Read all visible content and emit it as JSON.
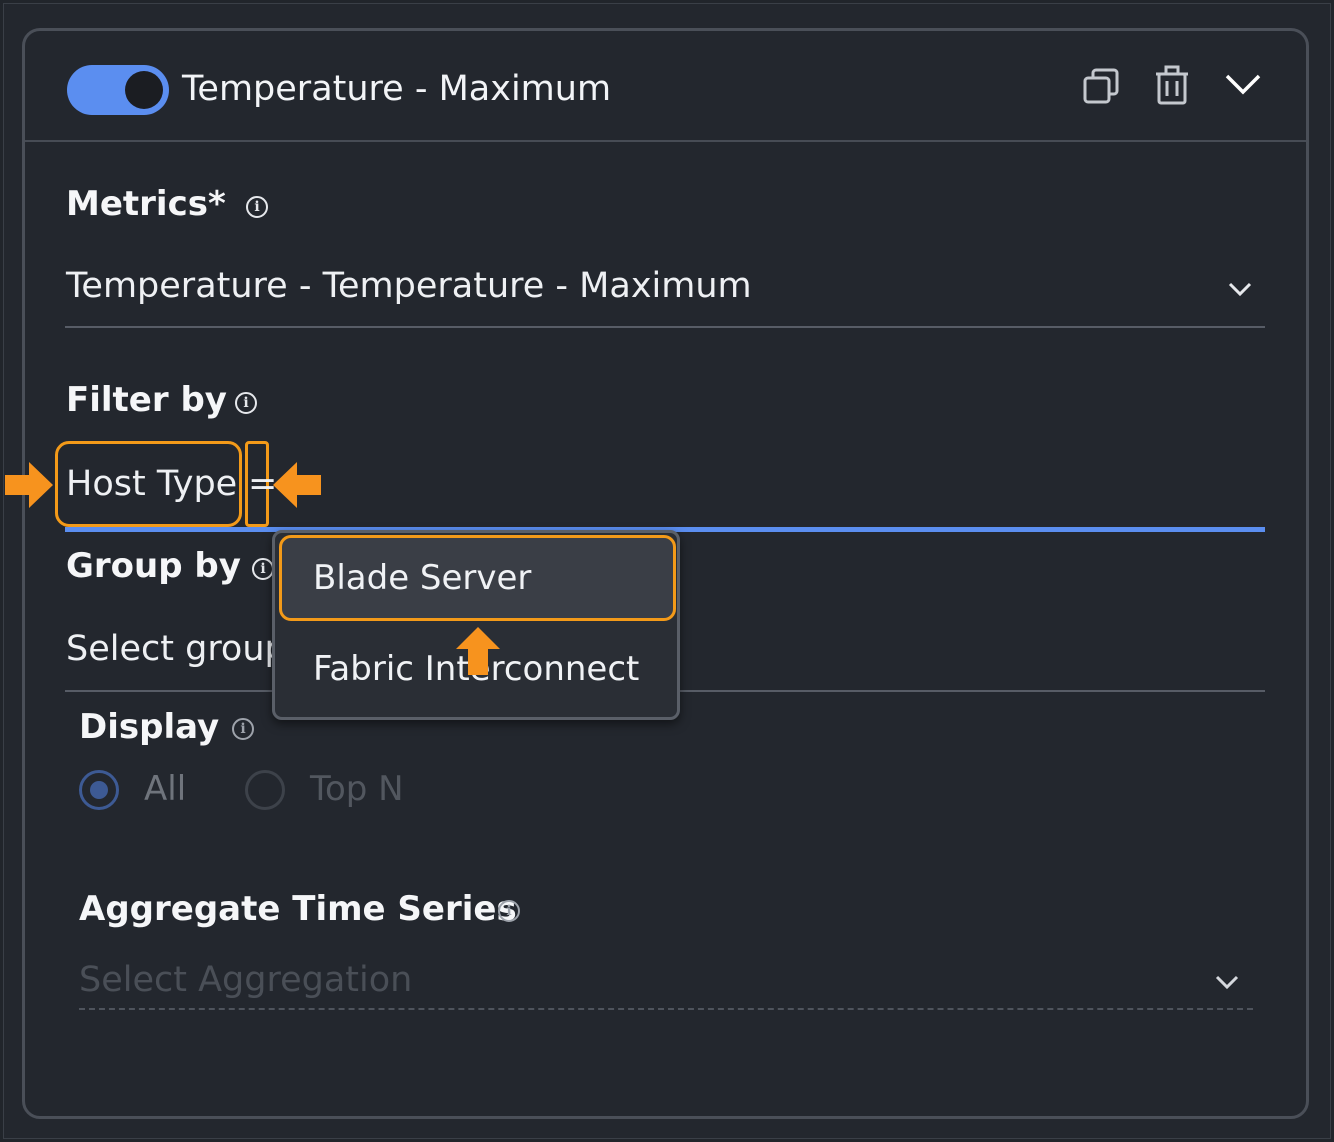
{
  "card": {
    "title": "Temperature - Maximum",
    "toggle_on": true
  },
  "metrics": {
    "label": "Metrics*",
    "value": "Temperature - Temperature - Maximum"
  },
  "filter": {
    "label": "Filter by",
    "key": "Host Type",
    "operator": "="
  },
  "group": {
    "label": "Group by",
    "placeholder": "Select group"
  },
  "dropdown": {
    "options": [
      "Blade Server",
      "Fabric Interconnect"
    ],
    "highlighted": "Blade Server"
  },
  "display": {
    "label": "Display",
    "options": [
      {
        "label": "All",
        "selected": true
      },
      {
        "label": "Top N",
        "selected": false
      }
    ]
  },
  "aggregate": {
    "label": "Aggregate Time Series",
    "placeholder": "Select Aggregation"
  },
  "icons": {
    "copy": "copy-icon",
    "delete": "trash-icon",
    "collapse": "chevron-down-icon",
    "info": "info-icon"
  },
  "colors": {
    "accent": "#5b8ef0",
    "highlight": "#f39a19",
    "background": "#23272e"
  }
}
